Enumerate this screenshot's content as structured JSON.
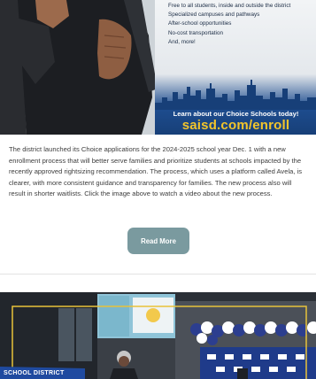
{
  "hero": {
    "benefits": [
      "Free to all students, inside and outside the district",
      "Specialized campuses and pathways",
      "After-school opportunities",
      "No-cost transportation",
      "And, more!"
    ],
    "cta_text": "Learn about our Choice Schools today!",
    "cta_url": "saisd.com/enroll",
    "colors": {
      "panel_blue": "#1e4d8f",
      "url_gold": "#f3c52b"
    }
  },
  "article": {
    "body": "The district launched its Choice applications for the 2024-2025 school year Dec. 1 with a new enrollment process that will better serve families and prioritize students at schools impacted by the recently approved rightsizing recommendation. The process, which uses a platform called Avela, is clearer, with more consistent guidance and transparency for families. The new process also will result in shorter waitlists. Click the image above to watch a video about the new process.",
    "read_more_label": "Read More",
    "button_color": "#7a9a9f"
  },
  "second_story": {
    "sign_text": "SCHOOL DISTRICT"
  }
}
